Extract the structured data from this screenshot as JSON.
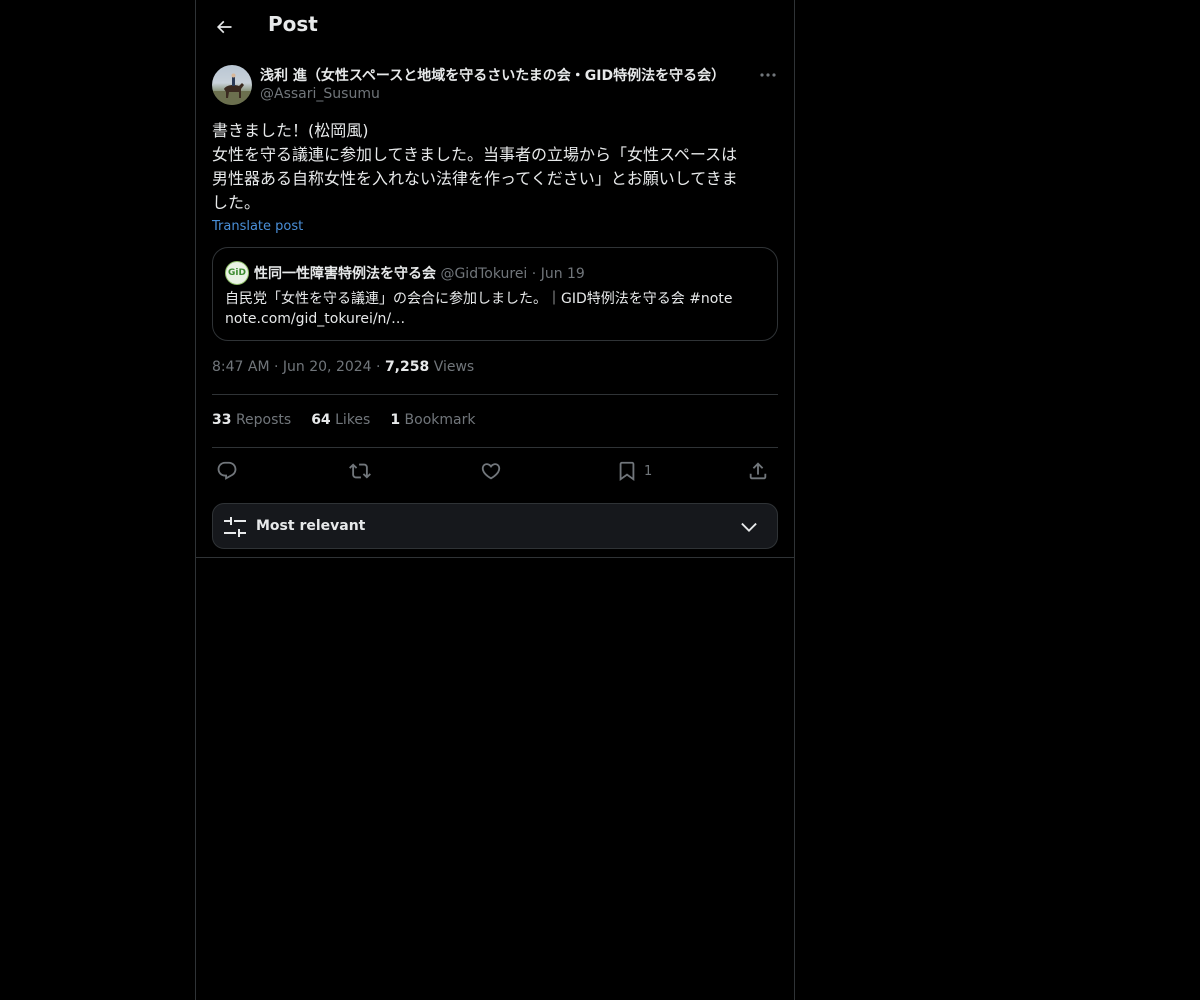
{
  "header": {
    "title": "Post"
  },
  "author": {
    "name": "浅利 進（女性スペースと地域を守るさいたまの会・GID特例法を守る会）",
    "handle": "@Assari_Susumu"
  },
  "post": {
    "lines": [
      "書きました！(松岡風)",
      "女性を守る議連に参加してきました。当事者の立場から「女性スペースは",
      "男性器ある自称女性を入れない法律を作ってください」とお願いしてきま",
      "した。"
    ],
    "translate_label": "Translate post"
  },
  "quote": {
    "avatar_text": "GiD",
    "name": "性同一性障害特例法を守る会",
    "handle": "@GidTokurei",
    "separator": "·",
    "date": "Jun 19",
    "lines": [
      "自民党「女性を守る議連」の会合に参加しました。｜GID特例法を守る会 #note",
      "note.com/gid_tokurei/n/…"
    ]
  },
  "meta": {
    "time": "8:47 AM",
    "separator": "·",
    "date": "Jun 20, 2024",
    "views_count": "7,258",
    "views_label": "Views"
  },
  "stats": {
    "reposts_count": "33",
    "reposts_label": "Reposts",
    "likes_count": "64",
    "likes_label": "Likes",
    "bookmarks_count": "1",
    "bookmarks_label": "Bookmark"
  },
  "actions": {
    "icons": [
      "reply-icon",
      "repost-icon",
      "like-icon",
      "bookmark-icon",
      "share-icon"
    ],
    "bookmark_count": "1"
  },
  "sort": {
    "label": "Most relevant"
  },
  "colors": {
    "background": "#000000",
    "text": "#e7e9ea",
    "muted": "#71767b",
    "border": "#2f3336",
    "link": "#4a8fd8"
  }
}
